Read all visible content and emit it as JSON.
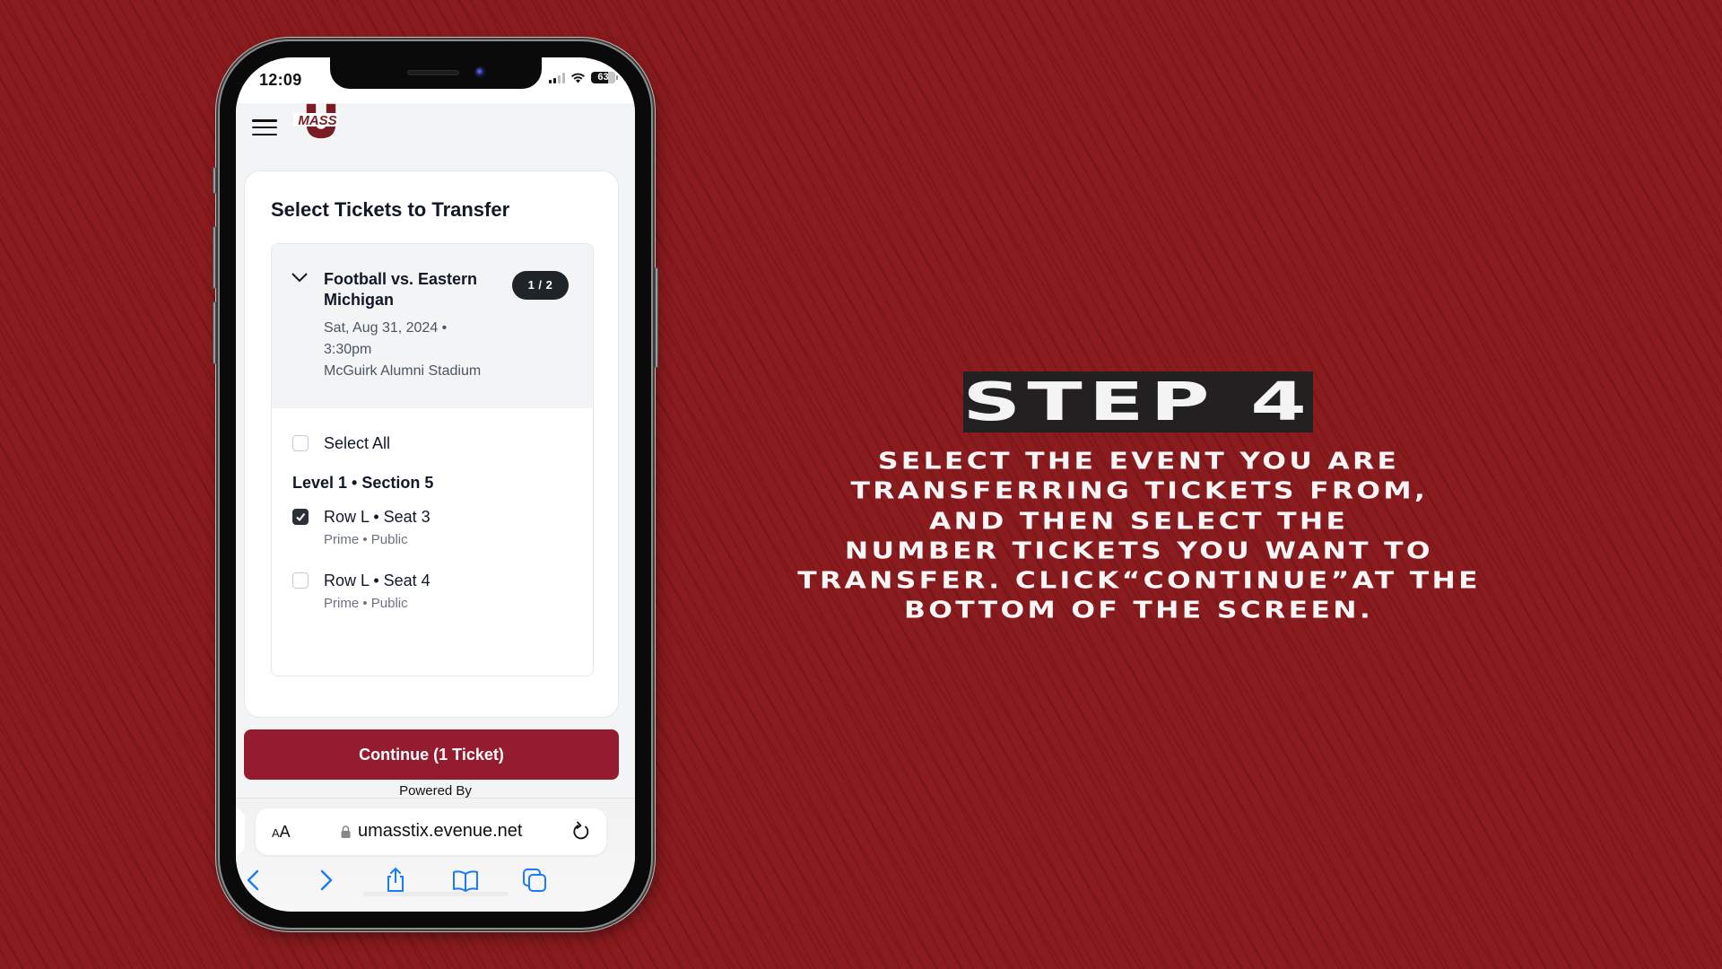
{
  "status_bar": {
    "time": "12:09",
    "battery": "63"
  },
  "site": {
    "logo_text": "MASS",
    "logo_letter": "U"
  },
  "card": {
    "title": "Select Tickets to Transfer",
    "event": {
      "name": "Football vs. Eastern Michigan",
      "date_line": "Sat, Aug 31, 2024 •",
      "time_line": "3:30pm",
      "venue": "McGuirk Alumni Stadium",
      "badge": "1 / 2"
    },
    "select_all_label": "Select All",
    "select_all_checked": false,
    "section_header": "Level 1 • Section 5",
    "seats": [
      {
        "label": "Row L • Seat 3",
        "sub": "Prime • Public",
        "checked": true
      },
      {
        "label": "Row L • Seat 4",
        "sub": "Prime • Public",
        "checked": false
      }
    ]
  },
  "continue_button": "Continue (1 Ticket)",
  "powered_by": "Powered By",
  "browser": {
    "aa_small": "A",
    "aa_large": "A",
    "url": "umasstix.evenue.net"
  },
  "instructions": {
    "step_label": "STEP 4",
    "lines": [
      "SELECT THE EVENT YOU ARE",
      "TRANSFERRING TICKETS FROM,",
      "AND THEN SELECT THE",
      "NUMBER TICKETS YOU WANT TO",
      "TRANSFER. CLICK“CONTINUE”AT THE",
      "BOTTOM OF THE SCREEN."
    ]
  },
  "colors": {
    "background": "#8a1b1e",
    "accent_maroon": "#951c2f",
    "badge_dark": "#1f2429",
    "ios_blue": "#1a7cf5",
    "step_box": "#222020"
  }
}
